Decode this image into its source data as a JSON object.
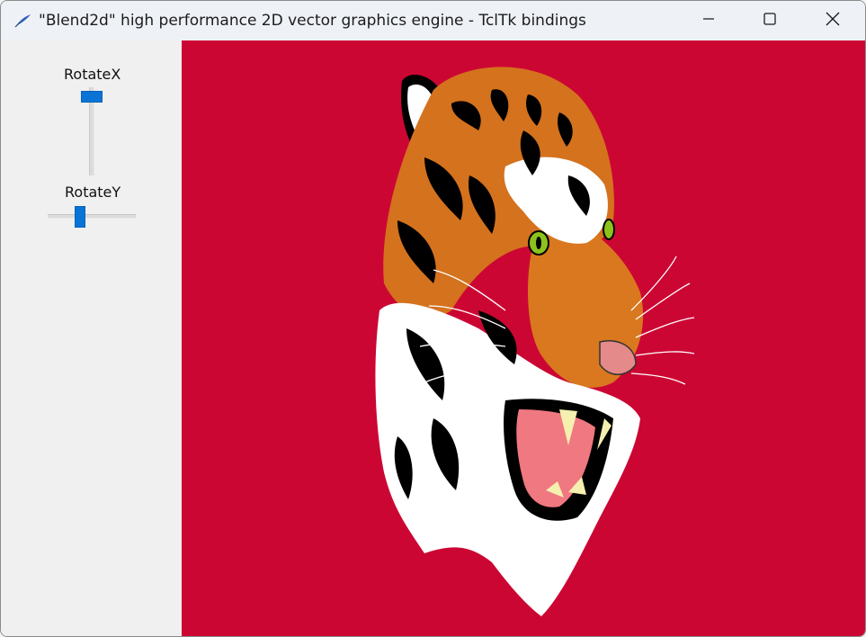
{
  "window": {
    "title": "\"Blend2d\" high performance 2D vector graphics engine - TclTk bindings",
    "icon": "feather-icon",
    "buttons": {
      "minimize": "minimize-icon",
      "maximize": "maximize-icon",
      "close": "close-icon"
    }
  },
  "controls": {
    "rotate_x": {
      "label": "RotateX",
      "orientation": "vertical",
      "value_fraction": 0.05
    },
    "rotate_y": {
      "label": "RotateY",
      "orientation": "horizontal",
      "value_fraction": 0.35
    }
  },
  "canvas": {
    "background_color": "#cc0633",
    "image": "tiger-illustration"
  },
  "colors": {
    "accent": "#0a74d6",
    "canvas_bg": "#cc0633"
  }
}
